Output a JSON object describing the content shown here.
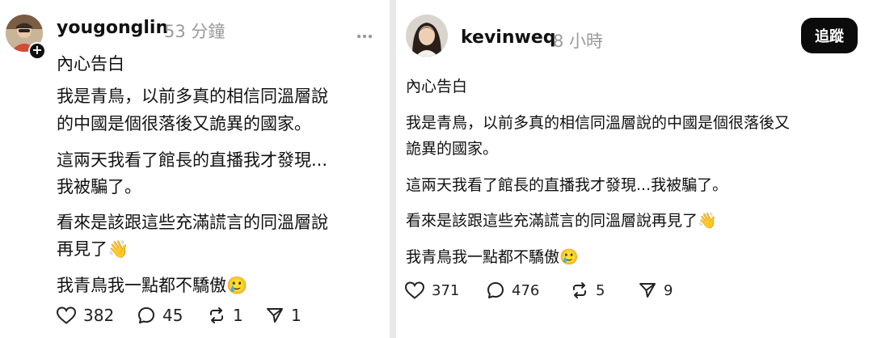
{
  "posts": [
    {
      "username": "yougonglin",
      "time": "53 分鐘",
      "title": "內心告白",
      "paragraphs": [
        [
          "我是青鳥，以前多真的相信同溫層說",
          "的中國是個很落後又詭異的國家。"
        ],
        [
          "這兩天我看了館長的直播我才發現...",
          "我被騙了。"
        ],
        [
          "看來是該跟這些充滿謊言的同溫層說",
          "再見了👋"
        ],
        [
          "我青鳥我一點都不驕傲🥲"
        ]
      ],
      "likes": "382",
      "comments": "45",
      "reposts": "1",
      "shares": "1"
    },
    {
      "username": "kevinweq",
      "time": "8 小時",
      "follow_label": "追蹤",
      "title": "內心告白",
      "paragraphs": [
        [
          "我是青鳥，以前多真的相信同溫層說的中國是個很落後又",
          "詭異的國家。"
        ],
        [
          "這兩天我看了館長的直播我才發現...我被騙了。"
        ],
        [
          "看來是該跟這些充滿謊言的同溫層說再見了👋"
        ],
        [
          "我青鳥我一點都不驕傲🥲"
        ]
      ],
      "likes": "371",
      "comments": "476",
      "reposts": "5",
      "shares": "9"
    }
  ]
}
